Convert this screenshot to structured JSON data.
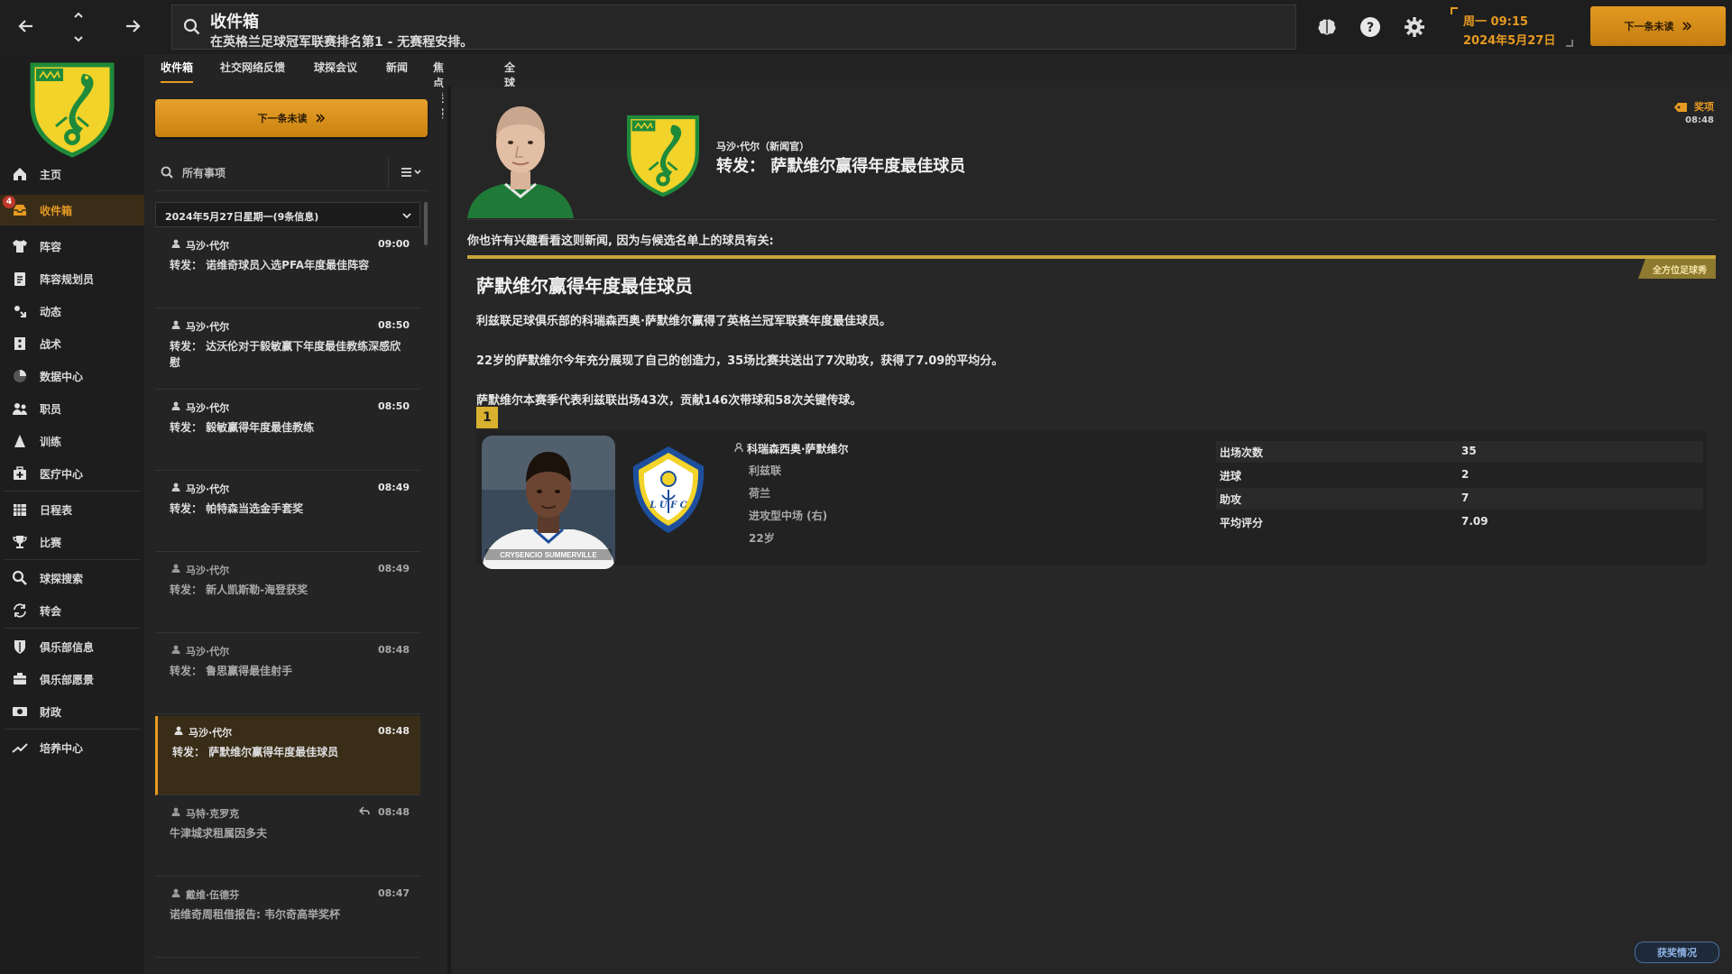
{
  "header": {
    "title": "收件箱",
    "subtitle": "在英格兰足球冠军联赛排名第1 - 无赛程安排。",
    "date_line1": "周一 09:15",
    "date_line2": "2024年5月27日",
    "next_unread_label": "下一条未读"
  },
  "sidebar": {
    "inbox_badge": "4",
    "items": [
      {
        "label": "主页",
        "icon": "home-icon"
      },
      {
        "label": "收件箱",
        "icon": "inbox-icon"
      },
      {
        "label": "阵容",
        "icon": "shirt-icon"
      },
      {
        "label": "阵容规划员",
        "icon": "clipboard-icon"
      },
      {
        "label": "动态",
        "icon": "dynamics-icon"
      },
      {
        "label": "战术",
        "icon": "tactics-icon"
      },
      {
        "label": "数据中心",
        "icon": "data-icon"
      },
      {
        "label": "职员",
        "icon": "staff-icon"
      },
      {
        "label": "训练",
        "icon": "training-icon"
      },
      {
        "label": "医疗中心",
        "icon": "medical-icon"
      },
      {
        "label": "日程表",
        "icon": "calendar-icon"
      },
      {
        "label": "比赛",
        "icon": "trophy-icon"
      },
      {
        "label": "球探搜索",
        "icon": "search-icon"
      },
      {
        "label": "转会",
        "icon": "transfer-icon"
      },
      {
        "label": "俱乐部信息",
        "icon": "shield-icon"
      },
      {
        "label": "俱乐部愿景",
        "icon": "vision-icon"
      },
      {
        "label": "财政",
        "icon": "finance-icon"
      },
      {
        "label": "培养中心",
        "icon": "development-icon"
      }
    ]
  },
  "tabs": [
    "收件箱",
    "社交网络反馈",
    "球探会议",
    "新闻",
    "焦点联赛",
    "全球要闻"
  ],
  "inbox": {
    "next_unread_label": "下一条未读",
    "filter_placeholder": "所有事项",
    "date_header": "2024年5月27日星期一(9条信息)",
    "messages": [
      {
        "sender": "马沙·代尔",
        "time": "09:00",
        "subject": "转发：  诺维奇球员入选PFA年度最佳阵容"
      },
      {
        "sender": "马沙·代尔",
        "time": "08:50",
        "subject": "转发：  达沃伦对于毅敏赢下年度最佳教练深感欣慰"
      },
      {
        "sender": "马沙·代尔",
        "time": "08:50",
        "subject": "转发：  毅敏赢得年度最佳教练"
      },
      {
        "sender": "马沙·代尔",
        "time": "08:49",
        "subject": "转发：  帕特森当选金手套奖"
      },
      {
        "sender": "马沙·代尔",
        "time": "08:49",
        "subject": "转发：  新人凯斯勒-海登获奖"
      },
      {
        "sender": "马沙·代尔",
        "time": "08:48",
        "subject": "转发：  鲁思赢得最佳射手"
      },
      {
        "sender": "马沙·代尔",
        "time": "08:48",
        "subject": "转发：  萨默维尔赢得年度最佳球员"
      },
      {
        "sender": "马特·克罗克",
        "time": "08:48",
        "subject": "牛津城求租属因多夫"
      },
      {
        "sender": "戴维·伍德芬",
        "time": "08:47",
        "subject": "诺维奇周租借报告: 韦尔奇高举奖杯"
      }
    ]
  },
  "article": {
    "from": "马沙·代尔（新闻官）",
    "subject": "转发：  萨默维尔赢得年度最佳球员",
    "tag": "奖项",
    "tag_time": "08:48",
    "intro": "你也许有兴趣看看这则新闻, 因为与候选名单上的球员有关:",
    "category": "全方位足球秀",
    "headline": "萨默维尔赢得年度最佳球员",
    "paragraphs": [
      "利兹联足球俱乐部的科瑞森西奥·萨默维尔赢得了英格兰冠军联赛年度最佳球员。",
      "22岁的萨默维尔今年充分展现了自己的创造力，35场比赛共送出了7次助攻，获得了7.09的平均分。",
      "萨默维尔本赛季代表利兹联出场43次，贡献146次带球和58次关键传球。"
    ],
    "rank": "1",
    "player": {
      "name": "科瑞森西奥·萨默维尔",
      "club": "利兹联",
      "nationality": "荷兰",
      "position": "进攻型中场 (右)",
      "age": "22岁",
      "photo_caption": "CRYSENCIO SUMMERVILLE"
    },
    "stats": [
      {
        "label": "出场次数",
        "value": "35"
      },
      {
        "label": "进球",
        "value": "2"
      },
      {
        "label": "助攻",
        "value": "7"
      },
      {
        "label": "平均评分",
        "value": "7.09"
      }
    ]
  },
  "footer": {
    "label": "获奖情况"
  },
  "colors": {
    "accent": "#e69a22",
    "norwich_yellow": "#f2d32a",
    "norwich_green": "#1f8a3a",
    "leeds_blue": "#1d4f9c"
  }
}
